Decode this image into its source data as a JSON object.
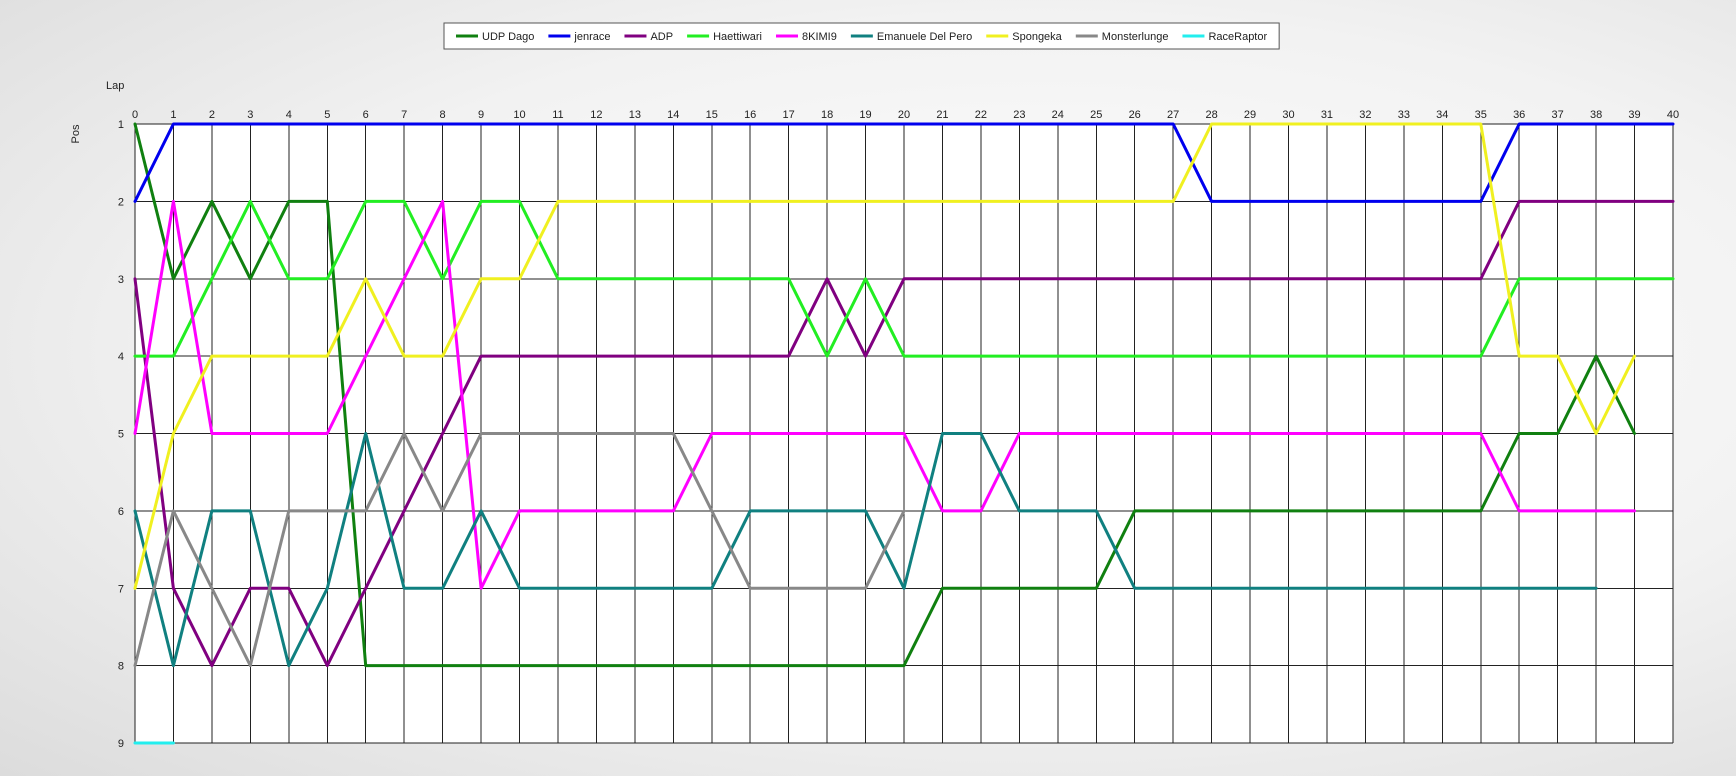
{
  "chart_data": {
    "type": "line",
    "title": "",
    "xlabel": "Lap",
    "ylabel": "Pos",
    "x": [
      0,
      1,
      2,
      3,
      4,
      5,
      6,
      7,
      8,
      9,
      10,
      11,
      12,
      13,
      14,
      15,
      16,
      17,
      18,
      19,
      20,
      21,
      22,
      23,
      24,
      25,
      26,
      27,
      28,
      29,
      30,
      31,
      32,
      33,
      34,
      35,
      36,
      37,
      38,
      39,
      40
    ],
    "xlim": [
      0,
      40
    ],
    "ylim": [
      1,
      9
    ],
    "y_inverted": true,
    "y_ticks": [
      1,
      2,
      3,
      4,
      5,
      6,
      7,
      8,
      9
    ],
    "x_axis_position": "top",
    "grid": true,
    "legend_position": "top",
    "series": [
      {
        "name": "UDP Dago",
        "color": "#108010",
        "values": [
          1,
          3,
          2,
          3,
          2,
          2,
          8,
          8,
          8,
          8,
          8,
          8,
          8,
          8,
          8,
          8,
          8,
          8,
          8,
          8,
          8,
          7,
          7,
          7,
          7,
          7,
          6,
          6,
          6,
          6,
          6,
          6,
          6,
          6,
          6,
          6,
          5,
          5,
          4,
          5
        ]
      },
      {
        "name": "jenrace",
        "color": "#0000ee",
        "values": [
          2,
          1,
          1,
          1,
          1,
          1,
          1,
          1,
          1,
          1,
          1,
          1,
          1,
          1,
          1,
          1,
          1,
          1,
          1,
          1,
          1,
          1,
          1,
          1,
          1,
          1,
          1,
          1,
          2,
          2,
          2,
          2,
          2,
          2,
          2,
          2,
          1,
          1,
          1,
          1,
          1
        ]
      },
      {
        "name": "ADP",
        "color": "#800080",
        "values": [
          3,
          7,
          8,
          7,
          7,
          8,
          7,
          6,
          5,
          4,
          4,
          4,
          4,
          4,
          4,
          4,
          4,
          4,
          3,
          4,
          3,
          3,
          3,
          3,
          3,
          3,
          3,
          3,
          3,
          3,
          3,
          3,
          3,
          3,
          3,
          3,
          2,
          2,
          2,
          2,
          2
        ]
      },
      {
        "name": "Haettiwari",
        "color": "#22ee22",
        "values": [
          4,
          4,
          3,
          2,
          3,
          3,
          2,
          2,
          3,
          2,
          2,
          3,
          3,
          3,
          3,
          3,
          3,
          3,
          4,
          3,
          4,
          4,
          4,
          4,
          4,
          4,
          4,
          4,
          4,
          4,
          4,
          4,
          4,
          4,
          4,
          4,
          3,
          3,
          3,
          3,
          3
        ]
      },
      {
        "name": "8KIMI9",
        "color": "#ff00ff",
        "values": [
          5,
          2,
          5,
          5,
          5,
          5,
          4,
          3,
          2,
          7,
          6,
          6,
          6,
          6,
          6,
          5,
          5,
          5,
          5,
          5,
          5,
          6,
          6,
          5,
          5,
          5,
          5,
          5,
          5,
          5,
          5,
          5,
          5,
          5,
          5,
          5,
          6,
          6,
          6,
          6
        ]
      },
      {
        "name": "Emanuele Del Pero",
        "color": "#108080",
        "values": [
          6,
          8,
          6,
          6,
          8,
          7,
          5,
          7,
          7,
          6,
          7,
          7,
          7,
          7,
          7,
          7,
          6,
          6,
          6,
          6,
          7,
          5,
          5,
          6,
          6,
          6,
          7,
          7,
          7,
          7,
          7,
          7,
          7,
          7,
          7,
          7,
          7,
          7,
          7
        ]
      },
      {
        "name": "Spongeka",
        "color": "#f0f020",
        "values": [
          7,
          5,
          4,
          4,
          4,
          4,
          3,
          4,
          4,
          3,
          3,
          2,
          2,
          2,
          2,
          2,
          2,
          2,
          2,
          2,
          2,
          2,
          2,
          2,
          2,
          2,
          2,
          2,
          1,
          1,
          1,
          1,
          1,
          1,
          1,
          1,
          4,
          4,
          5,
          4
        ]
      },
      {
        "name": "Monsterlunge",
        "color": "#888888",
        "values": [
          8,
          6,
          7,
          8,
          6,
          6,
          6,
          5,
          6,
          5,
          5,
          5,
          5,
          5,
          5,
          6,
          7,
          7,
          7,
          7,
          6
        ]
      },
      {
        "name": "RaceRaptor",
        "color": "#22eeee",
        "values": [
          9,
          9
        ]
      }
    ]
  }
}
